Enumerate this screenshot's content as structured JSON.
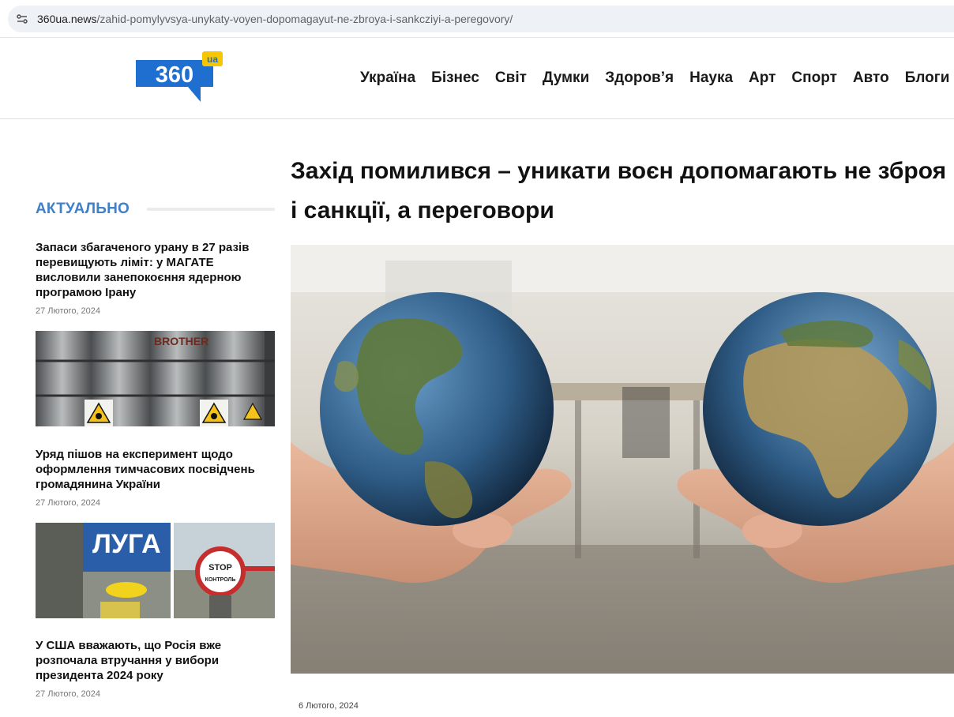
{
  "browser": {
    "url_host": "360ua.news",
    "url_path": "/zahid-pomylyvsya-unykaty-voyen-dopomagayut-ne-zbroya-i-sankcziyi-a-peregovory/"
  },
  "header": {
    "logo_text": "360",
    "logo_badge": "ua",
    "nav": [
      "Україна",
      "Бізнес",
      "Світ",
      "Думки",
      "Здоров’я",
      "Наука",
      "Арт",
      "Спорт",
      "Авто",
      "Блоги"
    ]
  },
  "sidebar": {
    "title": "АКТУАЛЬНО",
    "items": [
      {
        "title": "Запаси збагаченого урану в 27 разів перевищують ліміт: у МАГАТЕ висловили занепокоєння ядерною програмою Ірану",
        "date": "27 Лютого, 2024",
        "thumb_icon": "uranium-barrels"
      },
      {
        "title": "Уряд пішов на експеримент щодо оформлення тимчасових посвідчень громадянина України",
        "date": "27 Лютого, 2024",
        "thumb_icon": "border-control"
      },
      {
        "title": "У США вважають, що Росія вже розпочала втручання у вибори президента 2024 року",
        "date": "27 Лютого, 2024"
      }
    ],
    "thumb_labels": {
      "barrel_text": "BROTHER",
      "stop_sign": "STOP",
      "stop_sub": "КОНТРОЛЬ",
      "border_sign": "ЛУГА"
    }
  },
  "article": {
    "title": "Захід помилився – уникати воєн допомагають не зброя і санкції, а переговори",
    "date": "6 Лютого, 2024",
    "hero_icon": "hands-holding-globes"
  },
  "colors": {
    "accent": "#3f80c8",
    "logo_blue": "#1f6fd1",
    "logo_yellow": "#f6c600"
  }
}
